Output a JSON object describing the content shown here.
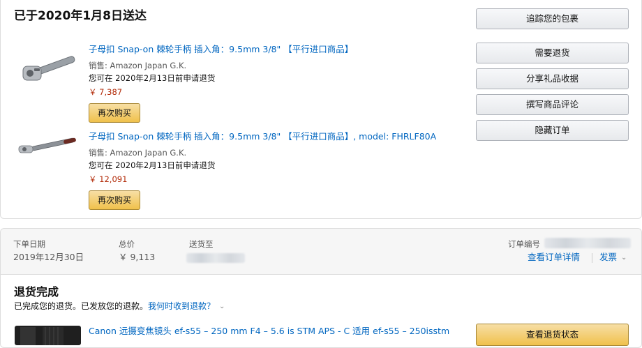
{
  "shipment": {
    "delivery_title": "已于2020年1月8日送达",
    "items": [
      {
        "title": "子母扣 Snap-on 棘轮手柄 插入角：9.5mm 3/8\" 【平行进口商品】",
        "seller": "销售: Amazon Japan G.K.",
        "return_note": "您可在 2020年2月13日前申请退货",
        "price": "￥ 7,387",
        "buy_again_label": "再次购买",
        "thumbnail_icon": "ratchet-handle-icon"
      },
      {
        "title": "子母扣 Snap-on 棘轮手柄 插入角：9.5mm 3/8\" 【平行进口商品】, model: FHRLF80A",
        "seller": "销售: Amazon Japan G.K.",
        "return_note": "您可在 2020年2月13日前申请退货",
        "price": "￥ 12,091",
        "buy_again_label": "再次购买",
        "thumbnail_icon": "long-ratchet-handle-icon"
      }
    ],
    "actions": [
      "追踪您的包裹",
      "需要退货",
      "分享礼品收据",
      "撰写商品评论",
      "隐藏订单"
    ]
  },
  "order": {
    "date_label": "下单日期",
    "date_value": "2019年12月30日",
    "total_label": "总价",
    "total_value": "￥ 9,113",
    "ship_to_label": "送货至",
    "order_number_label": "订单编号",
    "details_link": "查看订单详情",
    "invoice_link": "发票",
    "return_status_title": "退货完成",
    "refund_text": "已完成您的退货。已发放您的退款。",
    "refund_link": "我何时收到退款？",
    "item_title": "Canon 远摄变焦镜头 ef-s55 – 250 mm F4 – 5.6 is STM APS - C 适用 ef-s55 – 250isstm",
    "item_icon": "camera-lens-icon",
    "status_button": "查看退货状态"
  },
  "colors": {
    "link": "#0066c0",
    "price": "#b12704",
    "yellow_button": "#f0c14b",
    "header_bg": "#f6f6f6"
  }
}
